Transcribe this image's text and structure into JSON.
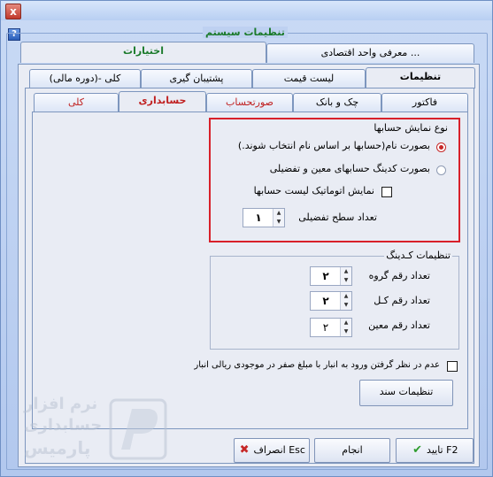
{
  "window": {
    "title": "تنظیمات سیستم",
    "close_label": "x",
    "help_label": "?"
  },
  "top_tabs": [
    {
      "label": "معرفی واحد اقتصادی ..."
    },
    {
      "label": "اختیارات"
    }
  ],
  "second_tabs": [
    {
      "label": "تنظیمات"
    },
    {
      "label": "لیست قیمت"
    },
    {
      "label": "پشتیبان گیری"
    },
    {
      "label": "کلی -(دوره مالی)"
    }
  ],
  "third_tabs": [
    {
      "label": "فاکتور"
    },
    {
      "label": "چک و بانک"
    },
    {
      "label": "صورتحساب"
    },
    {
      "label": "حسابداری"
    },
    {
      "label": "کلی"
    }
  ],
  "display_group": {
    "title": "نوع نمایش حسابها",
    "option_name_label": "بصورت نام(حسابها بر اساس نام انتخاب شوند.)",
    "option_name_checked": true,
    "option_code_label": "بصورت کدینگ حسابهای معین و تفضیلی",
    "option_code_checked": false,
    "auto_list_label": "نمایش اتوماتیک لیست حسابها",
    "auto_list_checked": false,
    "detail_levels_label": "تعداد سطح تفضیلی",
    "detail_levels_value": "۱"
  },
  "coding_group": {
    "title": "تنظیمات کـدینگ",
    "group_digits_label": "تعداد رقم گروه",
    "group_digits_value": "۲",
    "total_digits_label": "تعداد رقم کـل",
    "total_digits_value": "۲",
    "subsidiary_digits_label": "تعداد رقم معین",
    "subsidiary_digits_value": "۲"
  },
  "ignore_zero_label": "عدم در نظر گرفتن ورود به انبار با مبلغ صفر در موجودی ریالی انبار",
  "ignore_zero_checked": false,
  "document_settings_label": "تنظیمات سند",
  "footer": {
    "ok_label": "تایید F2",
    "apply_label": "انجام",
    "cancel_label": "انصراف Esc"
  },
  "watermark": {
    "line1": "نرم افزار",
    "line2": "حسابداری",
    "line3": "پارمیس"
  },
  "colors": {
    "accent_red": "#d8202a",
    "title_green": "#1a7a2a",
    "ok_check": "#2e9c2e",
    "cancel_x": "#c62828"
  },
  "icons": {
    "ok": "check-icon",
    "cancel": "x-icon",
    "help": "help-icon",
    "close": "close-icon"
  }
}
